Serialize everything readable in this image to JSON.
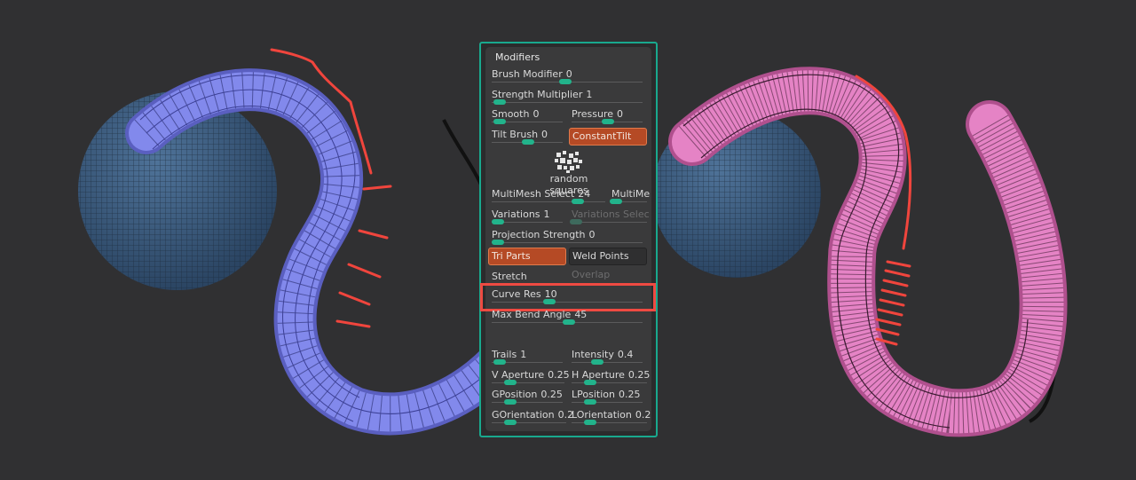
{
  "panel": {
    "title": "Modifiers",
    "brush_modifier": {
      "label": "Brush Modifier",
      "value": "0"
    },
    "strength_multiplier": {
      "label": "Strength Multiplier",
      "value": "1"
    },
    "smooth": {
      "label": "Smooth",
      "value": "0"
    },
    "pressure": {
      "label": "Pressure",
      "value": "0"
    },
    "tilt_brush": {
      "label": "Tilt Brush",
      "value": "0"
    },
    "constant_tilt": "ConstantTilt",
    "alpha_label": "random squares",
    "multimesh_select": {
      "label": "MultiMesh Select",
      "value": "24"
    },
    "multimesh_cut": "MultiMe",
    "variations": {
      "label": "Variations",
      "value": "1"
    },
    "variations_select": "Variations Selec",
    "projection_strength": {
      "label": "Projection Strength",
      "value": "0"
    },
    "tri_parts": "Tri Parts",
    "weld_points": "Weld Points",
    "stretch": "Stretch",
    "overlap": "Overlap",
    "curve_res": {
      "label": "Curve Res",
      "value": "10"
    },
    "max_bend_angle": {
      "label": "Max Bend Angle",
      "value": "45"
    },
    "trails": {
      "label": "Trails",
      "value": "1"
    },
    "intensity": {
      "label": "Intensity",
      "value": "0.4"
    },
    "v_aperture": {
      "label": "V Aperture",
      "value": "0.25"
    },
    "h_aperture": {
      "label": "H Aperture",
      "value": "0.25"
    },
    "gposition": {
      "label": "GPosition",
      "value": "0.25"
    },
    "lposition": {
      "label": "LPosition",
      "value": "0.25"
    },
    "gorientation": {
      "label": "GOrientation",
      "value": "0.2"
    },
    "lorientation": {
      "label": "LOrientation",
      "value": "0.2"
    }
  },
  "colors": {
    "panel_border": "#19a98e",
    "slider_knob": "#22b38b",
    "active_button": "#b54a25",
    "highlight": "#ef4a42",
    "left_mesh": "#7f86e8",
    "right_mesh": "#e47ec0",
    "sphere": "#3f5e80"
  }
}
